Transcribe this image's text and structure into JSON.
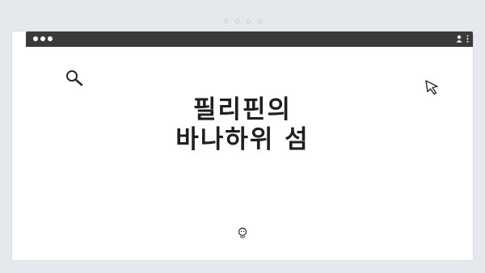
{
  "headline": {
    "line1": "필리핀의",
    "line2": "바나하위 섬"
  },
  "icons": {
    "search": "search-icon",
    "cursor": "cursor-pointer-icon",
    "user": "user-icon",
    "menu": "more-vertical-icon",
    "bottom": "face-icon"
  },
  "colors": {
    "background": "#e5e8ec",
    "titlebar": "#3a3a3a",
    "window": "#ffffff",
    "text": "#1f1f1f"
  }
}
